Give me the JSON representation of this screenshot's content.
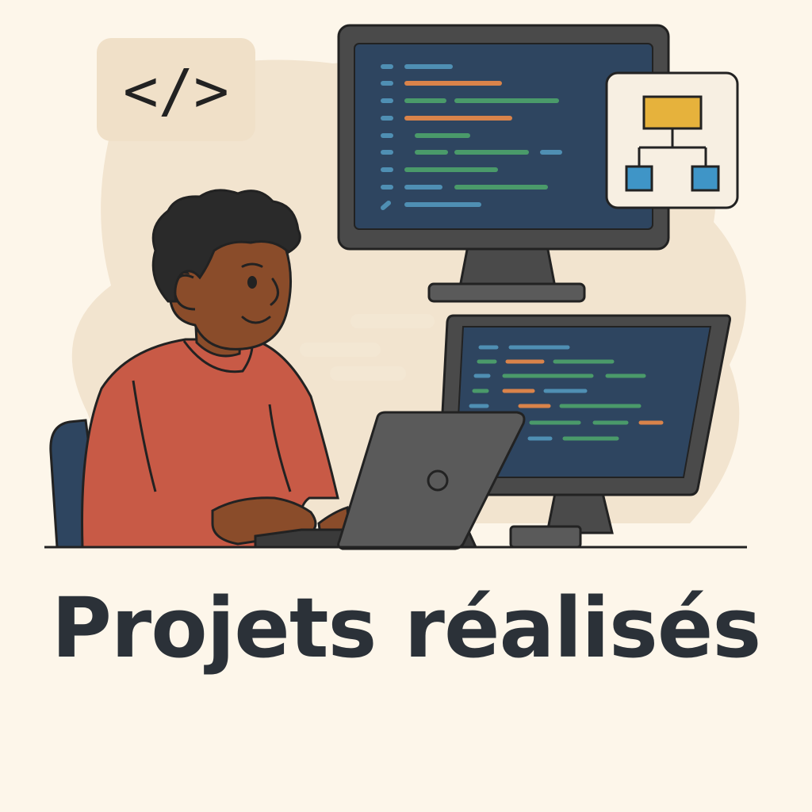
{
  "title": "Projets réalisés",
  "code_badge": {
    "icon": "code-tag-icon",
    "text": "</>"
  },
  "colors": {
    "background": "#fdf6ea",
    "blob": "#f2e4cf",
    "outline": "#222222",
    "screen": "#2e4560",
    "monitor_frame": "#4a4a4a",
    "code_blue": "#4f8fb3",
    "code_orange": "#d9834a",
    "code_green": "#4a9a6a",
    "diagram_top": "#e6b23c",
    "diagram_child": "#3f95c7",
    "shirt": "#c85a46",
    "skin": "#8a4c2a",
    "hair": "#2a2a2a",
    "chair": "#2e4560",
    "title": "#2b3138"
  },
  "icons": [
    "code-tag-icon",
    "hierarchy-diagram-icon",
    "camera-dot-icon"
  ]
}
